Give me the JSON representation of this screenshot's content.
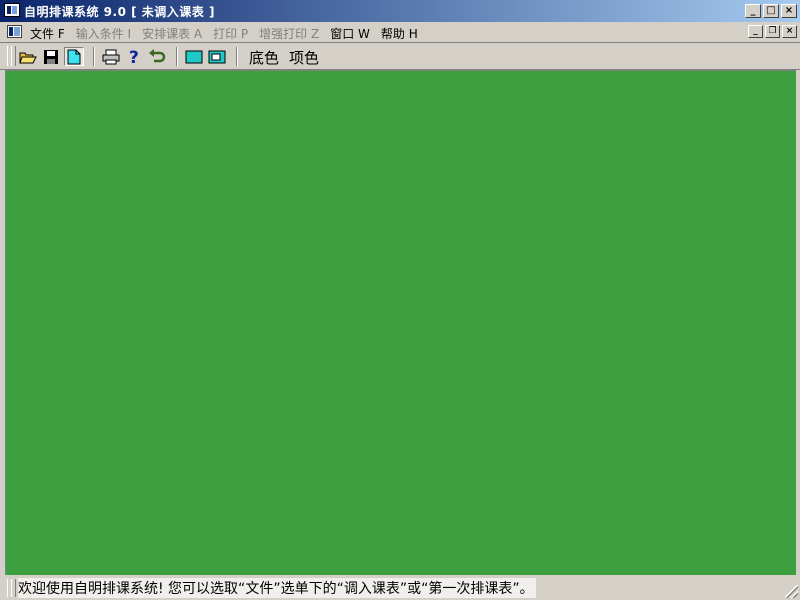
{
  "window": {
    "title": "自明排课系统 9.0 [ 未调入课表 ]"
  },
  "caption_buttons": {
    "minimize": "_",
    "maximize": "□",
    "close": "×"
  },
  "menubar": {
    "items": [
      {
        "label": "文件 F",
        "enabled": true
      },
      {
        "label": "输入条件 I",
        "enabled": false
      },
      {
        "label": "安排课表 A",
        "enabled": false
      },
      {
        "label": "打印 P",
        "enabled": false
      },
      {
        "label": "增强打印 Z",
        "enabled": false
      },
      {
        "label": "窗口 W",
        "enabled": true
      },
      {
        "label": "帮助 H",
        "enabled": true
      }
    ],
    "mdi_buttons": {
      "minimize": "_",
      "restore": "❐",
      "close": "×"
    }
  },
  "toolbar": {
    "icons": [
      "open-folder-icon",
      "save-disk-icon",
      "new-document-icon",
      "print-icon",
      "help-icon",
      "undo-icon",
      "color-swatch-icon",
      "color-swatch-2-icon"
    ],
    "text_buttons": [
      "底色",
      "项色"
    ]
  },
  "colors": {
    "client_background": "#3ca040",
    "titlebar_start": "#0a246a",
    "titlebar_end": "#a6caf0"
  },
  "statusbar": {
    "message": "欢迎使用自明排课系统!  您可以选取“文件”选单下的“调入课表”或“第一次排课表”。"
  }
}
